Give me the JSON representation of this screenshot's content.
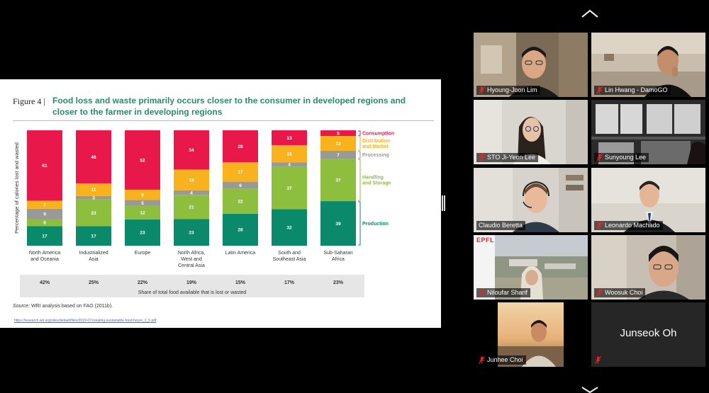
{
  "slide": {
    "figure_number": "Figure 4 |",
    "title": "Food loss and waste primarily occurs closer to the consumer in developed regions and closer to the farmer in developing regions",
    "source_label": "Source:",
    "source_text": " WRI analysis based on FAO (2011b).",
    "link": "https://research.wri.org/sites/default/files/2019-07/creating-sustainable-food-future_2_5.pdf"
  },
  "chart_data": {
    "type": "bar",
    "stacked": true,
    "ylabel": "Percentage of calories lost and wasted",
    "xlabel": "Share of total food available that is lost or wasted",
    "categories": [
      "North America and Oceania",
      "Industrialized Asia",
      "Europe",
      "North Africa, West and Central Asia",
      "Latin America",
      "South and Southeast Asia",
      "Sub-Saharan Africa"
    ],
    "category_lines": [
      [
        "North America",
        "and Oceania"
      ],
      [
        "Industrialized",
        "Asia"
      ],
      [
        "Europe"
      ],
      [
        "North Africa,",
        "West and",
        "Central Asia"
      ],
      [
        "Latin America"
      ],
      [
        "South and",
        "Southeast Asia"
      ],
      [
        "Sub-Saharan",
        "Africa"
      ]
    ],
    "series": [
      {
        "name": "Production",
        "color": "#0b8a6b",
        "values": [
          17,
          17,
          23,
          23,
          28,
          32,
          39
        ]
      },
      {
        "name": "Handling and Storage",
        "color": "#8ebe3e",
        "values": [
          6,
          23,
          12,
          21,
          22,
          37,
          37
        ]
      },
      {
        "name": "Processing",
        "color": "#999999",
        "values": [
          9,
          3,
          5,
          4,
          6,
          4,
          7
        ]
      },
      {
        "name": "Distribution and Market",
        "color": "#f7b21e",
        "values": [
          7,
          11,
          9,
          18,
          17,
          15,
          13
        ]
      },
      {
        "name": "Consumption",
        "color": "#e8194a",
        "values": [
          61,
          46,
          52,
          34,
          28,
          13,
          5
        ]
      }
    ],
    "legend_lines": [
      {
        "series": 4,
        "lines": [
          "Consumption"
        ]
      },
      {
        "series": 3,
        "lines": [
          "Distribution",
          "and Market"
        ]
      },
      {
        "series": 2,
        "lines": [
          "Processing"
        ]
      },
      {
        "series": 1,
        "lines": [
          "Handling",
          "and Storage"
        ]
      },
      {
        "series": 0,
        "lines": [
          "Production"
        ]
      }
    ],
    "shares": [
      "42%",
      "25%",
      "22%",
      "19%",
      "15%",
      "17%",
      "23%"
    ],
    "legend_position": "right"
  },
  "participants": [
    {
      "name": "Hyoung-Joon Lim",
      "muted": true
    },
    {
      "name": "Lin Hwang - DamoGO",
      "muted": true
    },
    {
      "name": "STO Ji-Yeon Lee",
      "muted": true
    },
    {
      "name": "Sunyoung Lee",
      "muted": true
    },
    {
      "name": "Claudio Beretta",
      "muted": false
    },
    {
      "name": "Leonardo Machado",
      "muted": true
    },
    {
      "name": "Niloufar Sharif",
      "muted": true
    },
    {
      "name": "Woosuk Choi",
      "muted": true
    },
    {
      "name": "Junhee Choi",
      "muted": true
    },
    {
      "name": "Junseok Oh",
      "muted": true
    }
  ],
  "tile_logo": "EPFL",
  "icons": {
    "mic_muted": "mic-muted-icon",
    "scroll_up": "chevron-up-icon",
    "scroll_down": "chevron-down-icon"
  },
  "colors": {
    "title_green": "#2a8a6a",
    "mute_red": "#e02828"
  }
}
